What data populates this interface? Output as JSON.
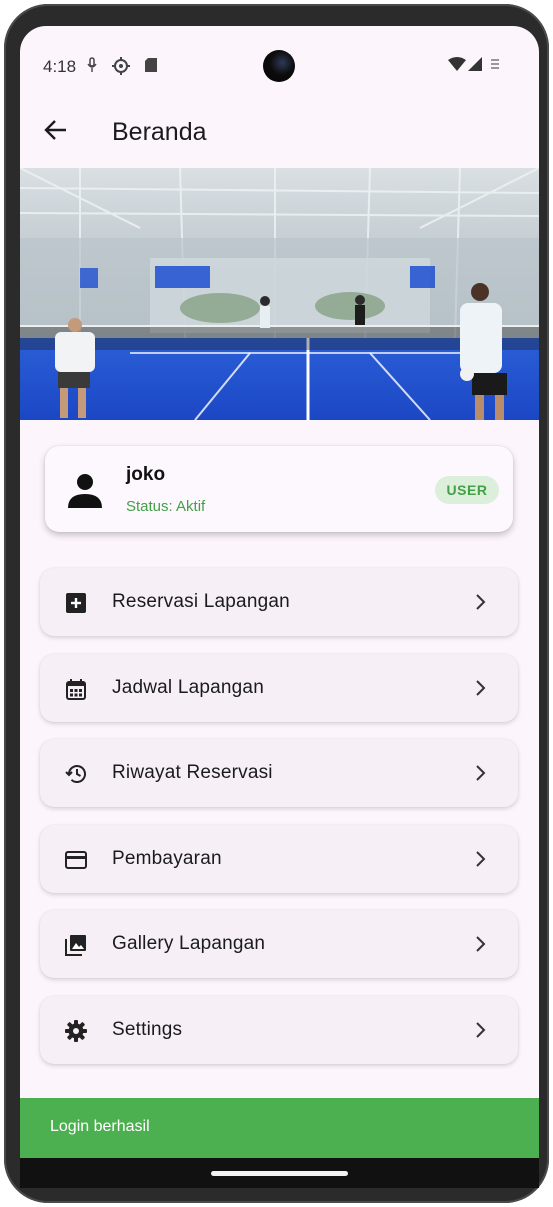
{
  "status_bar": {
    "time": "4:18"
  },
  "app_bar": {
    "title": "Beranda"
  },
  "profile": {
    "name": "joko",
    "status": "Status: Aktif",
    "role": "USER"
  },
  "menu": {
    "items": [
      {
        "label": "Reservasi Lapangan",
        "icon": "add-box-icon"
      },
      {
        "label": "Jadwal Lapangan",
        "icon": "calendar-icon"
      },
      {
        "label": "Riwayat Reservasi",
        "icon": "history-icon"
      },
      {
        "label": "Pembayaran",
        "icon": "credit-card-icon"
      },
      {
        "label": "Gallery Lapangan",
        "icon": "gallery-icon"
      },
      {
        "label": "Settings",
        "icon": "gear-icon"
      }
    ]
  },
  "snackbar": {
    "message": "Login berhasil"
  },
  "colors": {
    "background": "#fcf5fb",
    "accent_green": "#4caf50",
    "status_text_green": "#43a047",
    "badge_bg": "#dcefdb",
    "menu_card_bg": "#f6eff6"
  }
}
